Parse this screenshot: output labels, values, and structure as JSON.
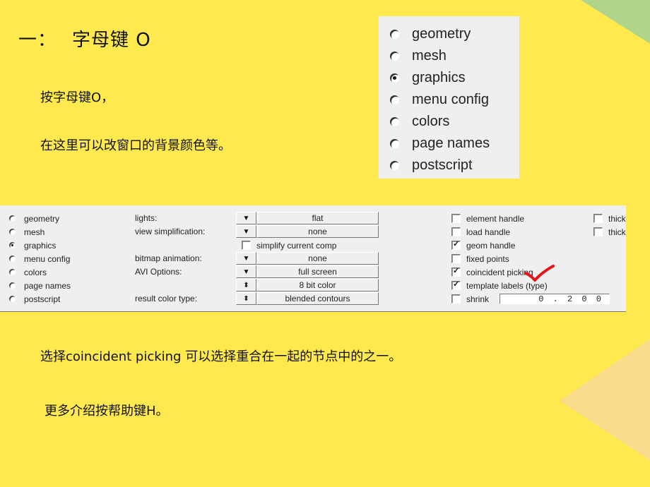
{
  "colors": {
    "background": "#ffe94f",
    "corner_green": "#b0d489",
    "arrow_tan": "#f8dc8c",
    "annotation_check": "#e8141c"
  },
  "slide": {
    "title_number": "一：",
    "title": "字母键 O",
    "line1": "按字母键O，",
    "line2": "在这里可以改窗口的背景颜色等。",
    "line3": "选择coincident picking 可以选择重合在一起的节点中的之一。",
    "line4": "更多介绍按帮助键H。"
  },
  "mini_panel": {
    "options": [
      {
        "label": "geometry",
        "selected": false
      },
      {
        "label": "mesh",
        "selected": false
      },
      {
        "label": "graphics",
        "selected": true
      },
      {
        "label": "menu config",
        "selected": false
      },
      {
        "label": "colors",
        "selected": false
      },
      {
        "label": "page names",
        "selected": false
      },
      {
        "label": "postscript",
        "selected": false
      }
    ]
  },
  "options_panel": {
    "pages": [
      {
        "label": "geometry",
        "selected": false
      },
      {
        "label": "mesh",
        "selected": false
      },
      {
        "label": "graphics",
        "selected": true
      },
      {
        "label": "menu config",
        "selected": false
      },
      {
        "label": "colors",
        "selected": false
      },
      {
        "label": "page names",
        "selected": false
      },
      {
        "label": "postscript",
        "selected": false
      }
    ],
    "settings": {
      "lights_label": "lights:",
      "lights_value": "flat",
      "view_simplification_label": "view simplification:",
      "view_simplification_value": "none",
      "simplify_current_comp_label": "simplify current comp",
      "simplify_current_comp_checked": false,
      "bitmap_animation_label": "bitmap animation:",
      "bitmap_animation_value": "none",
      "avi_options_label": "AVI Options:",
      "avi_options_value": "full screen",
      "color_depth_value": "8 bit color",
      "result_color_type_label": "result color type:",
      "result_color_type_value": "blended contours"
    },
    "checkboxes": [
      {
        "label": "element handle",
        "checked": false
      },
      {
        "label": "load handle",
        "checked": false
      },
      {
        "label": "geom handle",
        "checked": true
      },
      {
        "label": "fixed points",
        "checked": false
      },
      {
        "label": "coincident picking",
        "checked": true
      },
      {
        "label": "template labels (type)",
        "checked": true
      },
      {
        "label": "shrink",
        "checked": false
      }
    ],
    "right_checkboxes": [
      {
        "label": "thick",
        "checked": false
      },
      {
        "label": "thick",
        "checked": false
      }
    ],
    "shrink_value": "0.200"
  },
  "icons": {
    "dropdown_arrow": "▼",
    "spinner_arrow": "⬍"
  }
}
